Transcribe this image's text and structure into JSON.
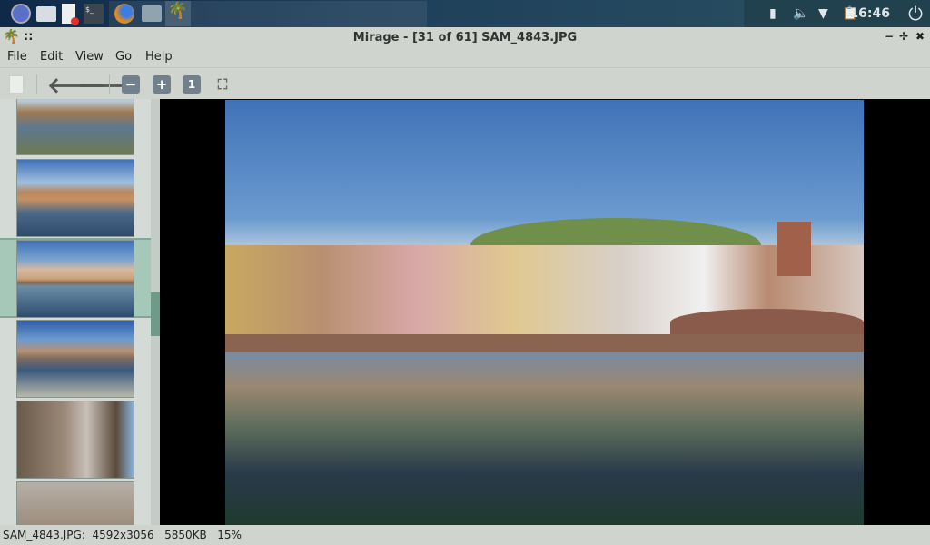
{
  "taskbar": {
    "launchers": [
      "browser-icon",
      "files-icon",
      "text-editor-icon",
      "terminal-icon"
    ],
    "tasks": [
      "firefox-icon",
      "folder-icon",
      "mirage-icon"
    ],
    "clock": "16:46"
  },
  "window": {
    "title": "Mirage - [31 of 61] SAM_4843.JPG",
    "grip": "::",
    "min": "−",
    "restore": "✢",
    "close": "✖"
  },
  "menu": [
    "File",
    "Edit",
    "View",
    "Go",
    "Help"
  ],
  "toolbar": {
    "zoom_out": "−",
    "zoom_in": "+",
    "actual": "1",
    "fit": "⛶",
    "back": "🡐",
    "forward": "🡒"
  },
  "thumbnails": {
    "count": 6,
    "selected": 2
  },
  "scroll": {
    "position_fraction": 0.5
  },
  "status": "SAM_4843.JPG:  4592x3056   5850KB   15%"
}
